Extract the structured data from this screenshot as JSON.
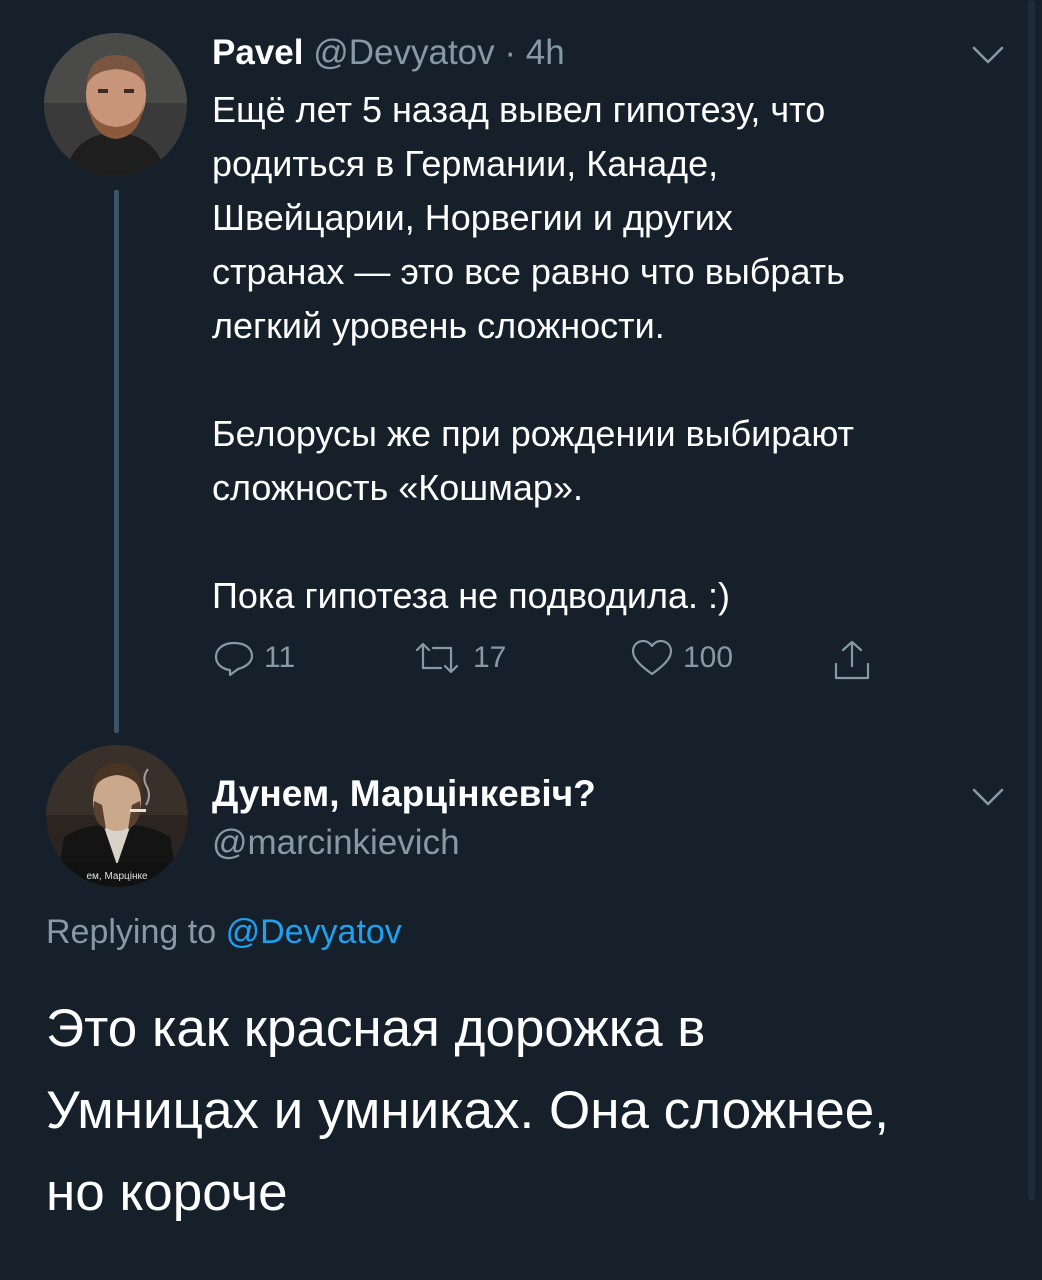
{
  "colors": {
    "background": "#15202b",
    "text_primary": "#ffffff",
    "text_secondary": "#8899a6",
    "link": "#1da1f2",
    "thread_line": "#3d5466"
  },
  "tweet1": {
    "name": "Pavel",
    "handle": "@Devyatov",
    "separator": "·",
    "time": "4h",
    "lines": [
      "Ещё лет 5 назад вывел гипотезу, что",
      "родиться в Германии, Канаде,",
      "Швейцарии, Норвегии и других",
      "странах — это все равно что выбрать",
      "легкий уровень сложности."
    ],
    "paragraph2_lines": [
      "Белорусы же при рождении выбирают",
      "сложность «Кошмар»."
    ],
    "paragraph3": "Пока гипотеза не подводила. :)",
    "actions": {
      "reply_icon": "reply-icon",
      "replies": "11",
      "retweet_icon": "retweet-icon",
      "retweets": "17",
      "like_icon": "heart-icon",
      "likes": "100",
      "share_icon": "share-icon"
    },
    "menu_icon": "chevron-down-icon"
  },
  "tweet2": {
    "name": "Дунем, Марцінкевіч?",
    "handle": "@marcinkievich",
    "avatar_caption": "ем, Марцінке",
    "replying_prefix": "Replying to",
    "replying_handle": "@Devyatov",
    "body_lines": [
      "Это как красная дорожка в",
      "Умницах и умниках. Она сложнее,",
      "но короче"
    ],
    "menu_icon": "chevron-down-icon"
  }
}
